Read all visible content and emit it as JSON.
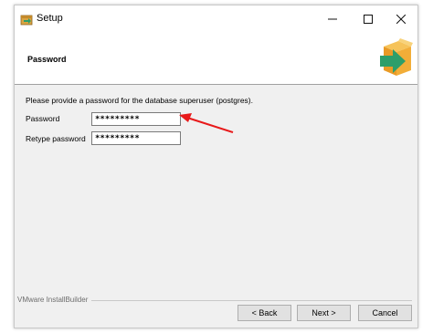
{
  "window": {
    "title": "Setup",
    "minimize_glyph": "—",
    "maximize_glyph": "☐",
    "close_glyph": "✕",
    "icon": "setup-package-icon"
  },
  "header": {
    "title": "Password",
    "graphic_icon": "box-arrow-icon"
  },
  "content": {
    "instruction": "Please provide a password for the database superuser (postgres).",
    "password_label": "Password",
    "password_value": "*********",
    "retype_label": "Retype password",
    "retype_value": "*********"
  },
  "annotation": {
    "arrow_color": "#e8191a"
  },
  "footer": {
    "brand": "VMware InstallBuilder",
    "back_label": "< Back",
    "next_label": "Next >",
    "cancel_label": "Cancel"
  },
  "colors": {
    "dialog_bg": "#f0f0f0",
    "header_bg": "#ffffff",
    "box_orange": "#f0a830",
    "arrow_green": "#2e9e6a"
  }
}
